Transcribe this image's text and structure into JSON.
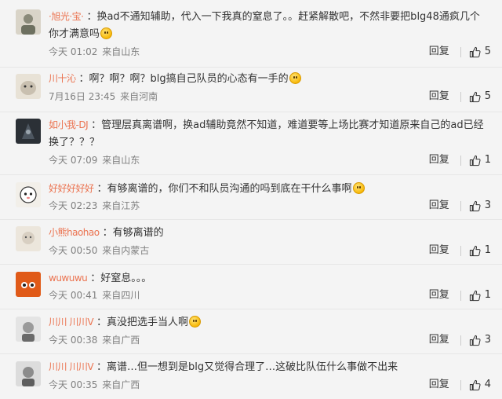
{
  "comments": [
    {
      "username": "·旭光·宝·",
      "colon": "：",
      "text": "换ad不通知辅助，代入一下我真的窒息了。。赶紧解散吧，不然非要把blg48通疯几个你才满意吗",
      "time": "今天 01:02",
      "location": "来自山东",
      "reply": "回复",
      "likes": "5",
      "avatar_color": "#8a8a7a"
    },
    {
      "username": "川十沁",
      "colon": "：",
      "text": "啊？啊？啊？blg搞自己队员的心态有一手的",
      "time": "7月16日 23:45",
      "location": "来自河南",
      "reply": "回复",
      "likes": "5",
      "avatar_color": "#c9c0b0"
    },
    {
      "username": "如小我-DJ",
      "colon": "：",
      "text": "管理层真离谱啊，换ad辅助竟然不知道，难道要等上场比赛才知道原来自己的ad已经换了？？？",
      "time": "今天 07:09",
      "location": "来自山东",
      "reply": "回复",
      "likes": "1",
      "avatar_color": "#2b3036"
    },
    {
      "username": "好好好好好",
      "colon": "：",
      "text": "有够离谱的，你们不和队员沟通的吗到底在干什么事啊",
      "time": "今天 02:23",
      "location": "来自江苏",
      "reply": "回复",
      "likes": "3",
      "avatar_color": "#f2efe9"
    },
    {
      "username": "小熊haohao",
      "colon": "：",
      "text": "有够离谱的",
      "time": "今天 00:50",
      "location": "来自内蒙古",
      "reply": "回复",
      "likes": "1",
      "avatar_color": "#d8cfc2"
    },
    {
      "username": "wuwuwu",
      "colon": "：",
      "text": "好窒息。。。",
      "time": "今天 00:41",
      "location": "来自四川",
      "reply": "回复",
      "likes": "1",
      "avatar_color": "#e05a18"
    },
    {
      "username": "川川 川川V",
      "colon": "：",
      "text": "真没把选手当人啊",
      "time": "今天 00:38",
      "location": "来自广西",
      "reply": "回复",
      "likes": "3",
      "avatar_color": "#c8c8c8"
    },
    {
      "username": "川川 川川V",
      "colon": "：",
      "text": "离谱…但一想到是blg又觉得合理了…这破比队伍什么事做不出来",
      "time": "今天 00:35",
      "location": "来自广西",
      "reply": "回复",
      "likes": "4",
      "avatar_color": "#b8b8b8"
    }
  ]
}
